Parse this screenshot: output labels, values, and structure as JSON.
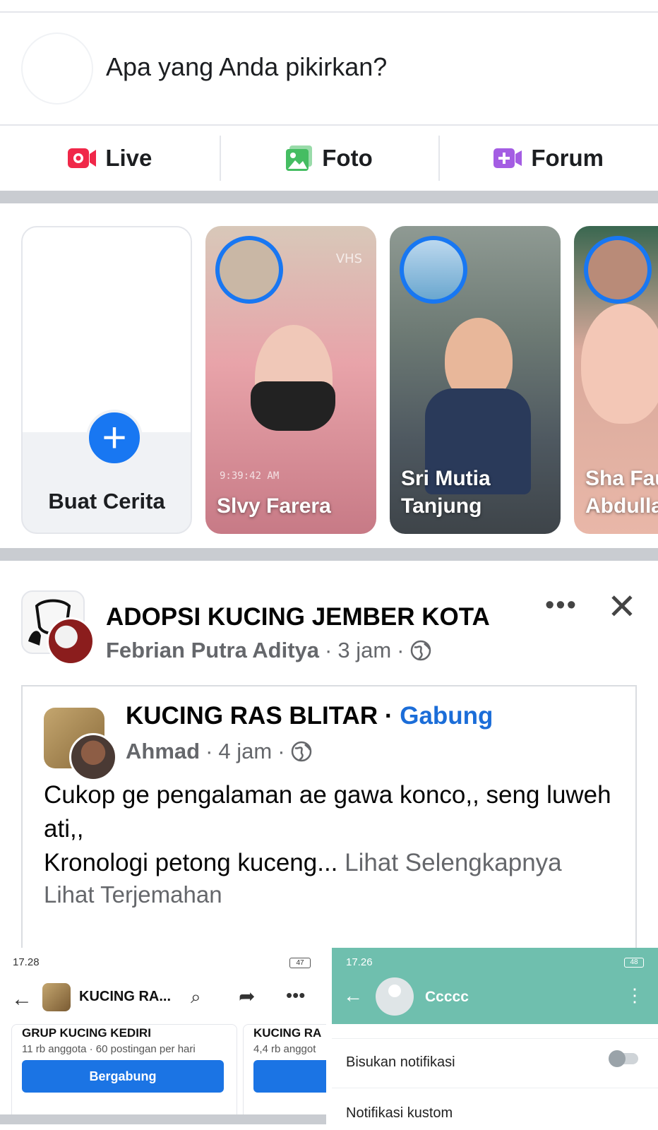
{
  "composer": {
    "prompt": "Apa yang Anda pikirkan?"
  },
  "actions": [
    {
      "label": "Live",
      "icon": "live-video-icon",
      "color": "#f02849"
    },
    {
      "label": "Foto",
      "icon": "photo-icon",
      "color": "#45bd62"
    },
    {
      "label": "Forum",
      "icon": "room-video-icon",
      "color": "#a45de3"
    }
  ],
  "stories": {
    "create_label": "Buat Cerita",
    "items": [
      {
        "name": "Slvy Farera",
        "timestamp": "9:39:42 AM",
        "overlay": "VHS"
      },
      {
        "name": "Sri Mutia Tanjung"
      },
      {
        "name": "Sha Fau Abdulla"
      }
    ]
  },
  "post": {
    "group": "ADOPSI KUCING JEMBER KOTA",
    "author": "Febrian Putra Aditya",
    "time": "3 jam",
    "sep": "·",
    "shared": {
      "group": "KUCING RAS BLITAR",
      "join": "Gabung",
      "author": "Ahmad",
      "time": "4 jam",
      "text_line1": "Cukop ge pengalaman ae gawa konco,, seng luweh ati,,",
      "text_line2": "Kronologi petong kuceng...",
      "see_more": "Lihat Selengkapnya",
      "translate": "Lihat Terjemahan"
    }
  },
  "screenshot_left": {
    "status_time": "17.28",
    "battery": "47",
    "title": "KUCING RA...",
    "card_a": {
      "title": "GRUP KUCING KEDIRI",
      "sub": "11 rb anggota · 60 postingan per hari",
      "button": "Bergabung"
    },
    "card_b": {
      "title": "KUCING RA",
      "sub": "4,4 rb anggot"
    }
  },
  "screenshot_right": {
    "status_time": "17.26",
    "battery": "48",
    "contact": "Ccccc",
    "row1": "Bisukan notifikasi",
    "row2": "Notifikasi kustom"
  }
}
